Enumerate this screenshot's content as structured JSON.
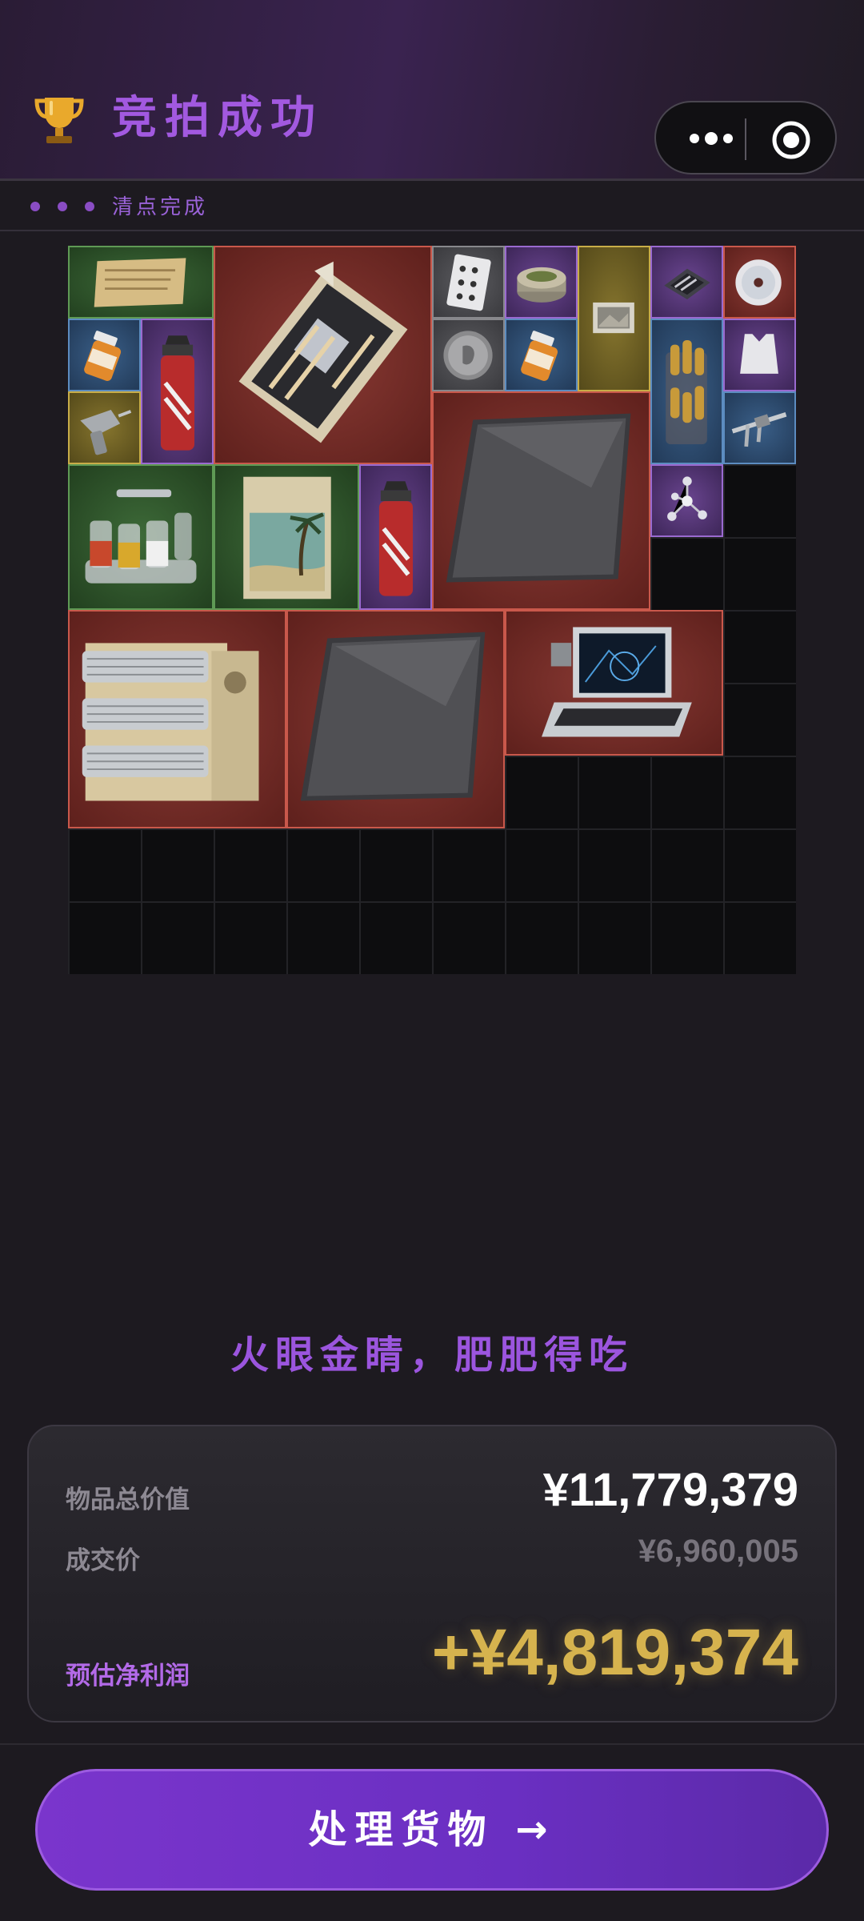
{
  "header": {
    "title": "竞拍成功",
    "trophy_icon": "trophy-icon",
    "more_icon": "more-dots-icon",
    "target_icon": "target-circle-icon"
  },
  "status": {
    "text": "清点完成"
  },
  "inventory": {
    "items": [
      {
        "name": "old-paper-scroll",
        "rarity": "green"
      },
      {
        "name": "motherboard",
        "rarity": "red"
      },
      {
        "name": "playing-card",
        "rarity": "gray"
      },
      {
        "name": "canned-food",
        "rarity": "purple"
      },
      {
        "name": "photo-print",
        "rarity": "gold"
      },
      {
        "name": "circuit-chip",
        "rarity": "purple"
      },
      {
        "name": "cd-disc",
        "rarity": "red"
      },
      {
        "name": "pill-bottle",
        "rarity": "blue"
      },
      {
        "name": "gas-canister",
        "rarity": "purple"
      },
      {
        "name": "old-coin",
        "rarity": "gray"
      },
      {
        "name": "pill-bottle",
        "rarity": "blue"
      },
      {
        "name": "ammo-box",
        "rarity": "blue"
      },
      {
        "name": "body-armor-vest",
        "rarity": "purple"
      },
      {
        "name": "drill-tool",
        "rarity": "gold"
      },
      {
        "name": "carbon-fiber-plate",
        "rarity": "red"
      },
      {
        "name": "caliper",
        "rarity": "blue"
      },
      {
        "name": "spice-rack",
        "rarity": "green"
      },
      {
        "name": "travel-poster",
        "rarity": "green"
      },
      {
        "name": "gas-canister",
        "rarity": "purple"
      },
      {
        "name": "molecule-model",
        "rarity": "purple"
      },
      {
        "name": "heat-sink-radiator",
        "rarity": "red"
      },
      {
        "name": "carbon-fiber-plate",
        "rarity": "red"
      },
      {
        "name": "rugged-laptop",
        "rarity": "red"
      }
    ]
  },
  "slogan": "火眼金睛，肥肥得吃",
  "summary": {
    "total_label": "物品总价值",
    "total_value": "¥11,779,379",
    "price_label": "成交价",
    "price_value": "¥6,960,005",
    "profit_label": "预估净利润",
    "profit_value": "+¥4,819,374"
  },
  "action_button": "处理货物 →",
  "colors": {
    "accent": "#a259e0",
    "profit": "#d6b34e",
    "button": "#7a35cc"
  }
}
